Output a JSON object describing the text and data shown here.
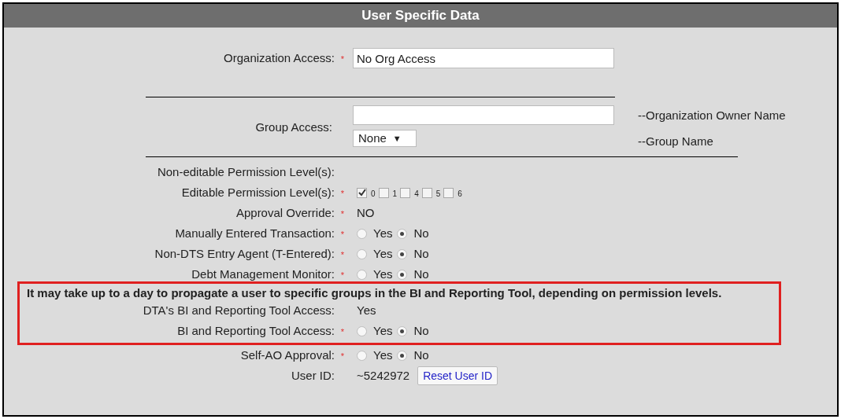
{
  "header": {
    "title": "User Specific Data"
  },
  "organization_access": {
    "label": "Organization Access:",
    "marker": "*",
    "value": "No Org Access"
  },
  "group_access": {
    "label": "Group Access:",
    "owner_hint": "--Organization Owner Name",
    "group_value": "None",
    "group_caret": "▼",
    "group_hint": "--Group Name"
  },
  "rows": [
    {
      "kind": "text",
      "label": "Non-editable Permission Level(s):"
    },
    {
      "kind": "checkboxes",
      "label": "Editable Permission Level(s):",
      "marker": "*",
      "options": [
        {
          "label": "0",
          "checked": true
        },
        {
          "label": "1",
          "checked": false
        },
        {
          "label": "4",
          "checked": false
        },
        {
          "label": "5",
          "checked": false
        },
        {
          "label": "6",
          "checked": false
        }
      ]
    },
    {
      "kind": "text",
      "label": "Approval Override:",
      "marker": "*",
      "value": "NO"
    },
    {
      "kind": "radio",
      "label": "Manually Entered Transaction:",
      "marker": "*",
      "options": [
        {
          "label": "Yes",
          "selected": false
        },
        {
          "label": "No",
          "selected": true
        }
      ]
    },
    {
      "kind": "radio",
      "label": "Non-DTS Entry Agent (T-Entered):",
      "marker": "*",
      "options": [
        {
          "label": "Yes",
          "selected": false
        },
        {
          "label": "No",
          "selected": true
        }
      ]
    },
    {
      "kind": "radio",
      "label": "Debt Management Monitor:",
      "marker": "*",
      "options": [
        {
          "label": "Yes",
          "selected": false
        },
        {
          "label": "No",
          "selected": true
        }
      ]
    }
  ],
  "notice": {
    "message": "It may take up to a day to propagate a user to specific groups in the BI and Reporting Tool, depending on permission levels.",
    "rows": [
      {
        "kind": "text",
        "label": "DTA's BI and Reporting Tool Access:",
        "value": "Yes"
      },
      {
        "kind": "radio",
        "label": "BI and Reporting Tool Access:",
        "marker": "*",
        "options": [
          {
            "label": "Yes",
            "selected": false
          },
          {
            "label": "No",
            "selected": true
          }
        ]
      }
    ]
  },
  "rows_after": [
    {
      "kind": "radio",
      "label": "Self-AO Approval:",
      "marker": "*",
      "options": [
        {
          "label": "Yes",
          "selected": false
        },
        {
          "label": "No",
          "selected": true
        }
      ]
    },
    {
      "kind": "button",
      "label": "User ID:",
      "value": "~5242972",
      "button": "Reset User ID"
    }
  ]
}
